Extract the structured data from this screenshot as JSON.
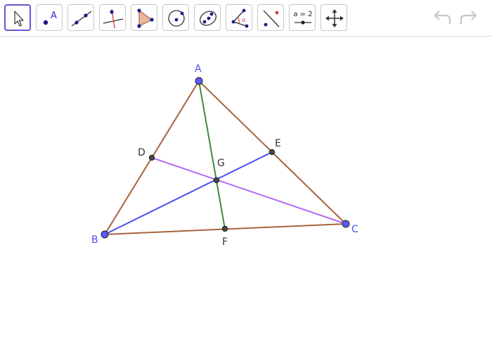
{
  "toolbar": {
    "tools": [
      {
        "name": "move-tool"
      },
      {
        "name": "point-tool",
        "glyph": "A"
      },
      {
        "name": "line-tool"
      },
      {
        "name": "perpendicular-line-tool"
      },
      {
        "name": "polygon-tool"
      },
      {
        "name": "circle-center-point-tool"
      },
      {
        "name": "conic-tool"
      },
      {
        "name": "angle-tool",
        "glyph": "α"
      },
      {
        "name": "reflect-tool"
      },
      {
        "name": "slider-tool",
        "glyph": "a = 2"
      },
      {
        "name": "move-graphics-view-tool"
      }
    ],
    "active_tool": "move-tool",
    "undo_enabled": false,
    "redo_enabled": false
  },
  "construction": {
    "points": {
      "A": {
        "label": "A",
        "color": "#4e4ef2"
      },
      "B": {
        "label": "B",
        "color": "#4e4ef2"
      },
      "C": {
        "label": "C",
        "color": "#4e4ef2"
      },
      "D": {
        "label": "D",
        "color": "#333333"
      },
      "E": {
        "label": "E",
        "color": "#333333"
      },
      "F": {
        "label": "F",
        "color": "#333333"
      },
      "G": {
        "label": "G",
        "color": "#333333"
      }
    },
    "colors": {
      "triangle_sides": "#a5643c",
      "median_A": "#3f8a3c",
      "median_B": "#4e4ef2",
      "median_C": "#b26cf2",
      "free_point_fill": "#5a5aff",
      "dependent_point_fill": "#4a4a4a"
    }
  }
}
